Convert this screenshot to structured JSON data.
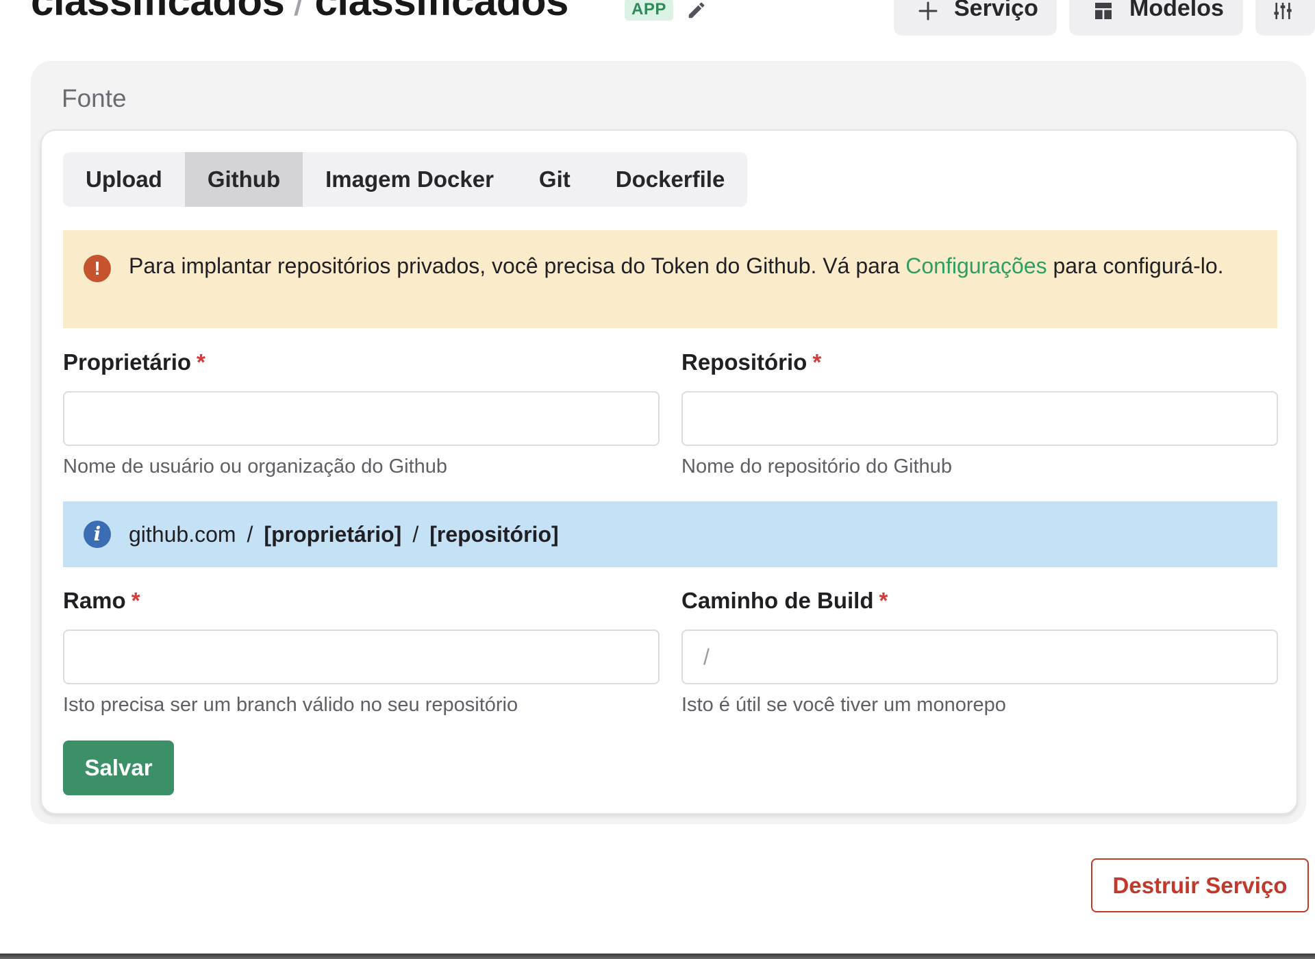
{
  "header": {
    "breadcrumb_project": "classificados",
    "breadcrumb_separator": "/",
    "breadcrumb_service": "classificados",
    "badge": "APP",
    "add_service_label": "Serviço",
    "templates_label": "Modelos"
  },
  "source": {
    "section_title": "Fonte",
    "tabs": [
      {
        "label": "Upload",
        "active": false
      },
      {
        "label": "Github",
        "active": true
      },
      {
        "label": "Imagem Docker",
        "active": false
      },
      {
        "label": "Git",
        "active": false
      },
      {
        "label": "Dockerfile",
        "active": false
      }
    ],
    "warning": {
      "text_before": "Para implantar repositórios privados, você precisa do Token do Github. Vá para ",
      "link": "Configurações",
      "text_after": " para configurá-lo.",
      "icon": "exclamation-icon",
      "color": "#faebcb"
    },
    "owner": {
      "label": "Proprietário",
      "required_mark": "*",
      "value": "",
      "placeholder": "",
      "help": "Nome de usuário ou organização do Github"
    },
    "repository": {
      "label": "Repositório",
      "required_mark": "*",
      "value": "",
      "placeholder": "",
      "help": "Nome do repositório do Github"
    },
    "path_preview": {
      "host": "github.com",
      "separator": "/",
      "owner": "[proprietário]",
      "repository": "[repositório]",
      "icon": "info-icon",
      "color": "#c5e1f6"
    },
    "branch": {
      "label": "Ramo",
      "required_mark": "*",
      "value": "",
      "placeholder": "",
      "help": "Isto precisa ser um branch válido no seu repositório"
    },
    "build_path": {
      "label": "Caminho de Build",
      "required_mark": "*",
      "value": "",
      "placeholder": "/",
      "help": "Isto é útil se você tiver um monorepo"
    },
    "save_label": "Salvar"
  },
  "danger": {
    "destroy_label": "Destruir Serviço"
  },
  "colors": {
    "accent_green": "#3b9068",
    "link_green": "#2e9e63",
    "danger_red": "#c0392b",
    "required_red": "#d13b3b",
    "badge_bg": "#dcf2e6"
  }
}
